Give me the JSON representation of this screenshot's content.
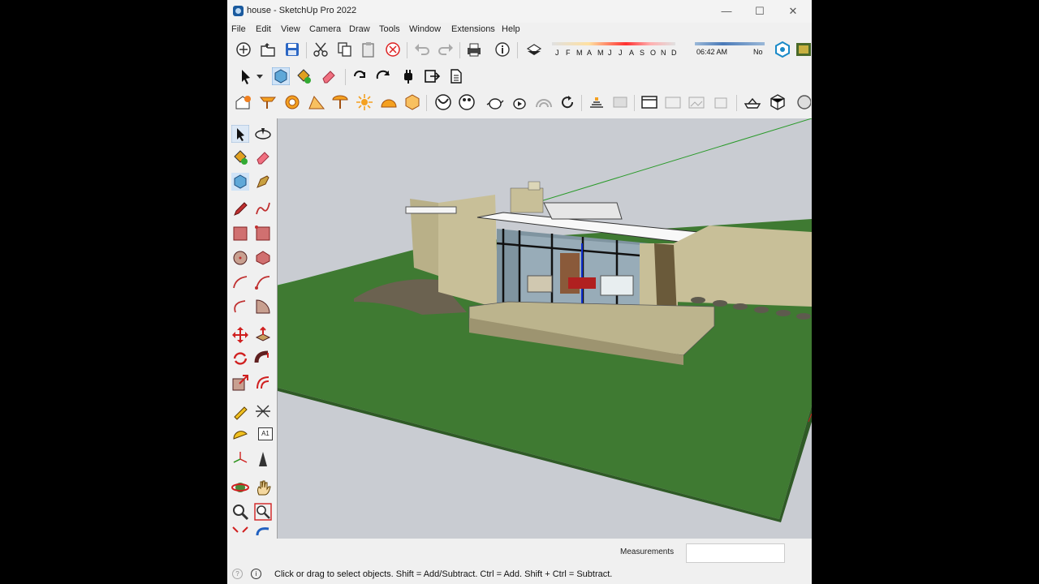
{
  "window": {
    "title": "house - SketchUp Pro 2022",
    "controls": {
      "minimize": "—",
      "maximize": "☐",
      "close": "✕"
    }
  },
  "menubar": [
    "File",
    "Edit",
    "View",
    "Camera",
    "Draw",
    "Tools",
    "Window",
    "Extensions",
    "Help"
  ],
  "shadow_settings": {
    "months": [
      "J",
      "F",
      "M",
      "A",
      "M",
      "J",
      "J",
      "A",
      "S",
      "O",
      "N",
      "D"
    ],
    "time": "06:42 AM",
    "noon_label": "No"
  },
  "toolbar_top": {
    "icons": [
      "new-icon",
      "open-icon",
      "save-icon",
      "cut-icon",
      "copy-icon",
      "paste-icon",
      "erase-icon",
      "undo-icon",
      "redo-icon",
      "print-icon",
      "model-info-icon",
      "shadow-toggle-icon"
    ]
  },
  "toolbar_second": {
    "icons": [
      "select-icon",
      "dropdown-arrow-icon",
      "component-icon",
      "paint-bucket-icon",
      "eraser-icon",
      "rotate-icon",
      "rotate-arrow-icon",
      "plugin-icon",
      "export-icon",
      "document-icon"
    ]
  },
  "toolbar_third": {
    "icons": [
      "house-gear-icon",
      "table-icon",
      "circle-target-icon",
      "stair-icon",
      "umbrella-icon",
      "sun-icon",
      "dome-icon",
      "hex-box-icon",
      "arc-icon",
      "palette-icon",
      "teapot-icon",
      "teapot-play-icon",
      "rainbow-icon",
      "refresh-icon",
      "door-icon",
      "panel-icon",
      "window-icon",
      "cabinet-icon",
      "frame-icon",
      "locker-icon",
      "ship-icon",
      "cube-icon",
      "partial-icon"
    ]
  },
  "left_toolbar": {
    "icons": [
      [
        "select-arrow-icon",
        "orbit-icon"
      ],
      [
        "paint-bucket-icon",
        "eraser-icon"
      ],
      [
        "make-component-icon",
        "tag-icon"
      ],
      [
        "pencil-icon",
        "freehand-icon"
      ],
      [
        "rectangle-icon",
        "rotated-rectangle-icon"
      ],
      [
        "circle-icon",
        "polygon-icon"
      ],
      [
        "arc-icon",
        "two-point-arc-icon"
      ],
      [
        "three-point-arc-icon",
        "pie-icon"
      ],
      [
        "move-icon",
        "push-pull-icon"
      ],
      [
        "rotate-tool-icon",
        "follow-me-icon"
      ],
      [
        "scale-icon",
        "offset-icon"
      ],
      [
        "tape-measure-icon",
        "dimension-icon"
      ],
      [
        "protractor-icon",
        "text-icon"
      ],
      [
        "axes-icon",
        "3d-text-icon"
      ],
      [
        "orbit-tool-icon",
        "pan-icon"
      ],
      [
        "zoom-icon",
        "zoom-window-icon"
      ],
      [
        "zoom-extents-icon",
        "previous-view-icon"
      ]
    ],
    "text_label": "A1"
  },
  "status": {
    "measurements_label": "Measurements",
    "status_text": "Click or drag to select objects. Shift = Add/Subtract. Ctrl = Add. Shift + Ctrl = Subtract."
  },
  "colors": {
    "sky": "#c9ccd2",
    "grass": "#3f7a32",
    "stone": "#c8bf98",
    "accent_blue": "#1a5a9e"
  }
}
